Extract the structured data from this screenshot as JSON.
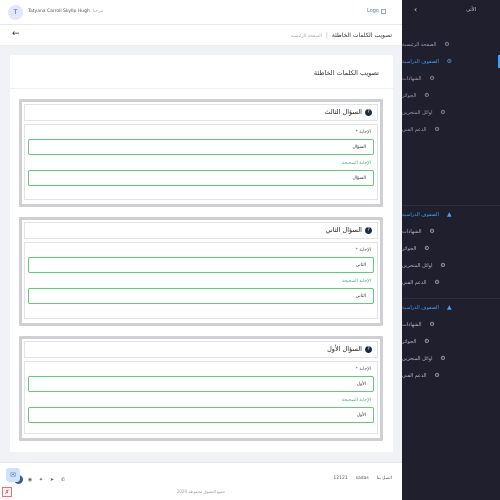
{
  "header": {
    "user_name": "Tatyana Carroll Skyllp Hugh",
    "greeting": "مرحبا",
    "avatar_letter": "T",
    "logo_text": "Logo"
  },
  "breadcrumb": {
    "current": "تصويب الكلمات الخاطئة",
    "previous": "الصفحة الرئيسية"
  },
  "sidebar": {
    "brand": "الأتى",
    "collapse_icon": "chevron-left-icon",
    "sections": [
      {
        "items": [
          {
            "label": "الصفحة الرئيسية",
            "icon": "gear-icon",
            "active": false
          },
          {
            "label": "الصفوف الدراسية",
            "icon": "gear-icon",
            "active": true
          },
          {
            "label": "الشهادات",
            "icon": "gear-icon",
            "active": false
          },
          {
            "label": "الجوائز",
            "icon": "gear-icon",
            "active": false
          },
          {
            "label": "اوائل المتحرين",
            "icon": "gear-icon",
            "active": false
          },
          {
            "label": "الدعم الفني",
            "icon": "gear-icon",
            "active": false
          }
        ]
      },
      {
        "items": [
          {
            "label": "الصفوف الدراسية",
            "icon": "graduation-icon",
            "active": true
          },
          {
            "label": "الشهادات",
            "icon": "gear-icon",
            "active": false
          },
          {
            "label": "الجوائز",
            "icon": "gear-icon",
            "active": false
          },
          {
            "label": "اوائل المتحرين",
            "icon": "gear-icon",
            "active": false
          },
          {
            "label": "الدعم الفني",
            "icon": "gear-icon",
            "active": false
          }
        ]
      },
      {
        "items": [
          {
            "label": "الصفوف الدراسية",
            "icon": "graduation-icon",
            "active": true
          },
          {
            "label": "الشهادات",
            "icon": "gear-icon",
            "active": false
          },
          {
            "label": "الجوائز",
            "icon": "gear-icon",
            "active": false
          },
          {
            "label": "اوائل المتحرين",
            "icon": "gear-icon",
            "active": false
          },
          {
            "label": "الدعم الفني",
            "icon": "gear-icon",
            "active": false
          }
        ]
      }
    ]
  },
  "card": {
    "title": "تصويب الكلمات الخاطئة"
  },
  "questions": [
    {
      "title": "السؤال الثالث",
      "answer_label": "الإجابة *",
      "answer_value": "السؤال",
      "correct_label": "الإجابة الصحيحة",
      "correct_value": "السؤال"
    },
    {
      "title": "السؤال الثاني",
      "answer_label": "الإجابة *",
      "answer_value": "الثاني",
      "correct_label": "الإجابة الصحيحة",
      "correct_value": "الثاني"
    },
    {
      "title": "السؤال الأول",
      "answer_label": "الإجابة *",
      "answer_value": "الأول",
      "correct_label": "الإجابة الصحيحة",
      "correct_value": "الأول"
    }
  ],
  "footer": {
    "left_label": "sadas",
    "middle_label": "12121",
    "right_label": "اتصل بنا",
    "copyright": "جميع الحقوق محفوظة 2020",
    "social_icons": [
      "facebook-icon",
      "instagram-icon",
      "twitter-icon",
      "telegram-icon",
      "whatsapp-icon"
    ]
  },
  "colors": {
    "sidebar_bg": "#1f1f2d",
    "accent": "#3aa1ff",
    "field_border": "#69c97a",
    "correct_label": "#3cb371"
  }
}
